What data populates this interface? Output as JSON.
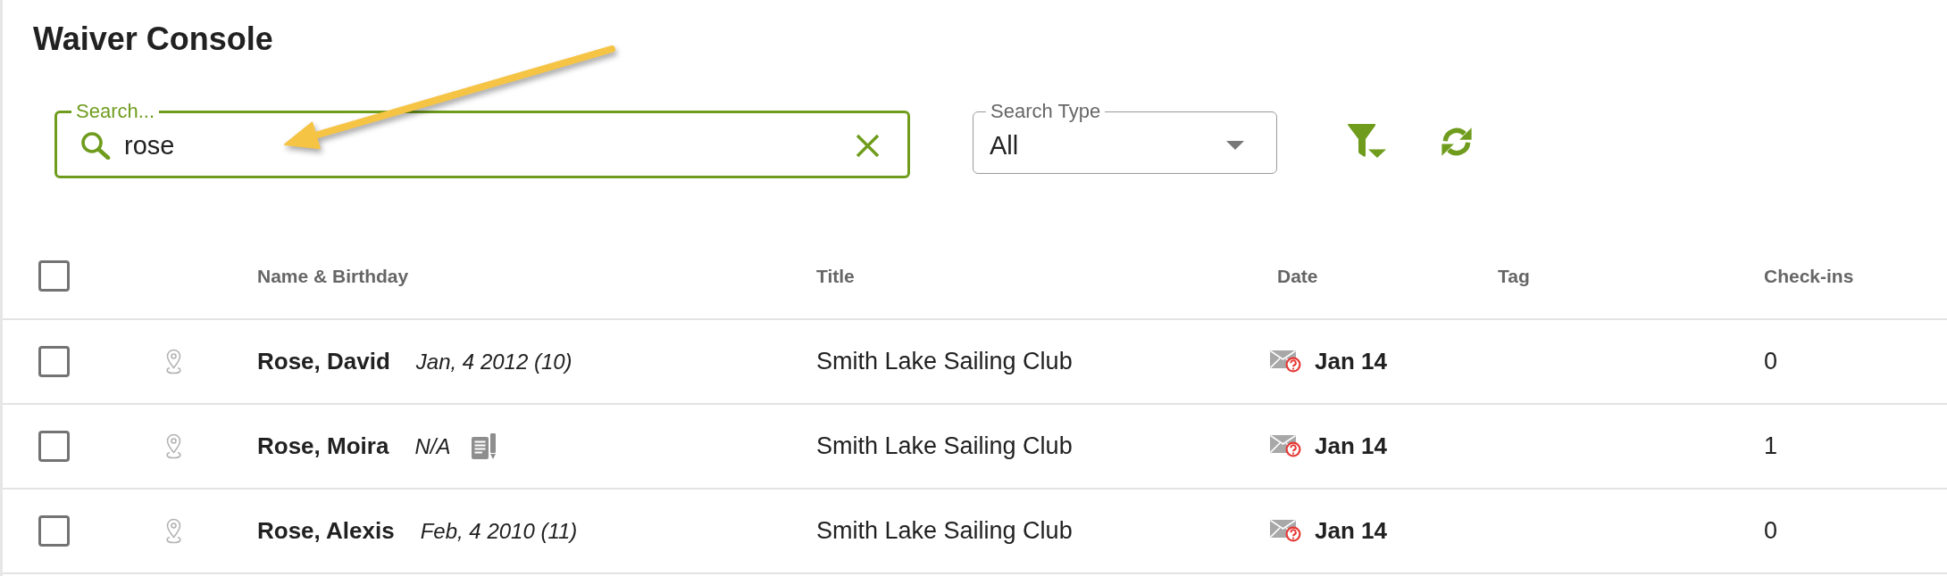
{
  "page": {
    "title": "Waiver Console"
  },
  "search": {
    "label": "Search...",
    "value": "rose"
  },
  "search_type": {
    "label": "Search Type",
    "value": "All"
  },
  "table": {
    "select_all": {
      "checked": false
    },
    "columns": [
      "Name & Birthday",
      "Title",
      "Date",
      "Tag",
      "Check-ins"
    ],
    "rows": [
      {
        "checked": false,
        "name": "Rose, David",
        "birthday": "Jan, 4 2012 (10)",
        "has_document": false,
        "title": "Smith Lake Sailing Club",
        "date": "Jan 14",
        "check_ins": "0"
      },
      {
        "checked": false,
        "name": "Rose, Moira",
        "birthday": "N/A",
        "has_document": true,
        "title": "Smith Lake Sailing Club",
        "date": "Jan 14",
        "check_ins": "1"
      },
      {
        "checked": false,
        "name": "Rose, Alexis",
        "birthday": "Feb, 4 2010 (11)",
        "has_document": false,
        "title": "Smith Lake Sailing Club",
        "date": "Jan 14",
        "check_ins": "0"
      }
    ]
  }
}
